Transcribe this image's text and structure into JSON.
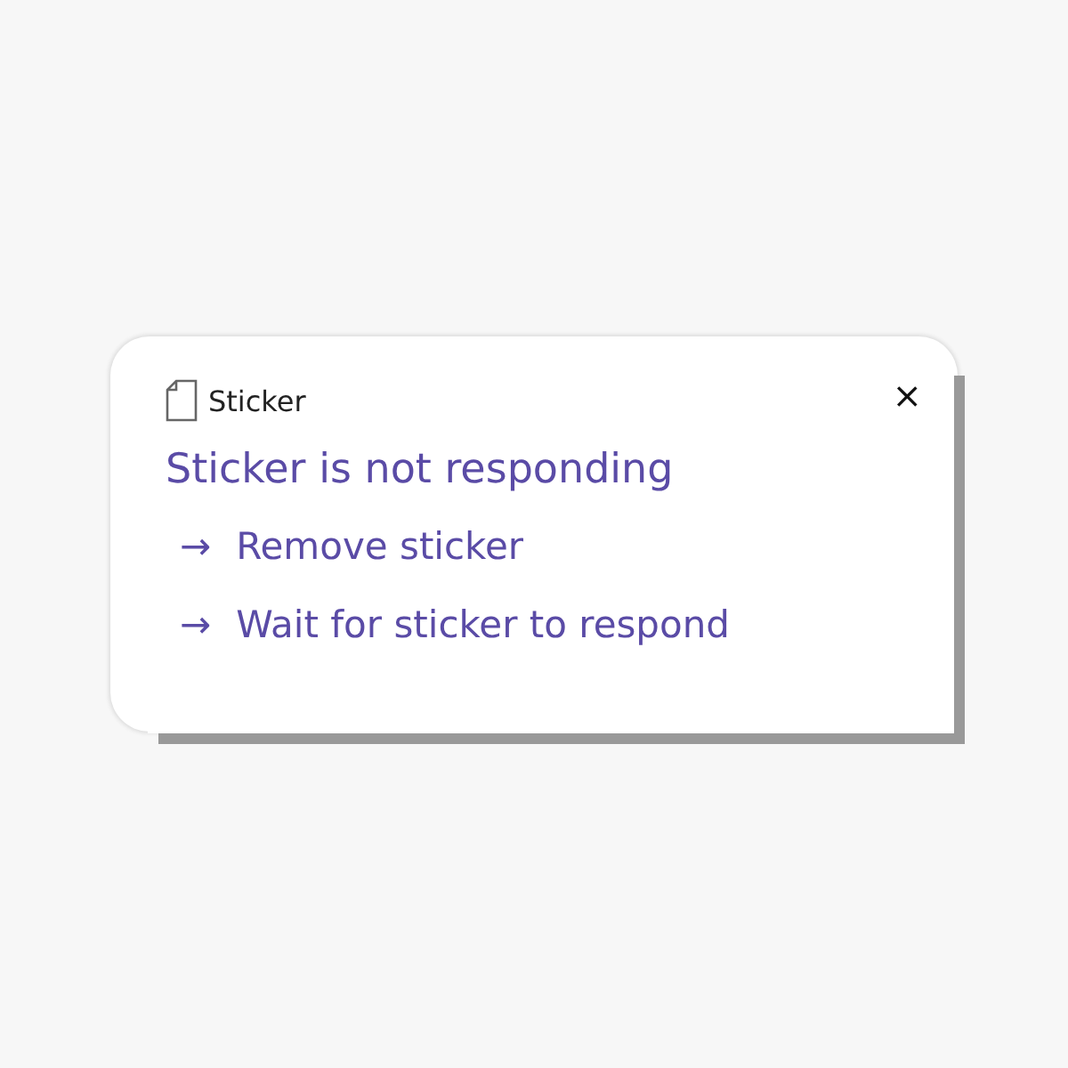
{
  "window": {
    "title": "Sticker",
    "close": "×"
  },
  "heading": "Sticker is not responding",
  "options": [
    {
      "arrow": "→",
      "label": "Remove sticker"
    },
    {
      "arrow": "→",
      "label": "Wait for sticker to respond"
    }
  ]
}
